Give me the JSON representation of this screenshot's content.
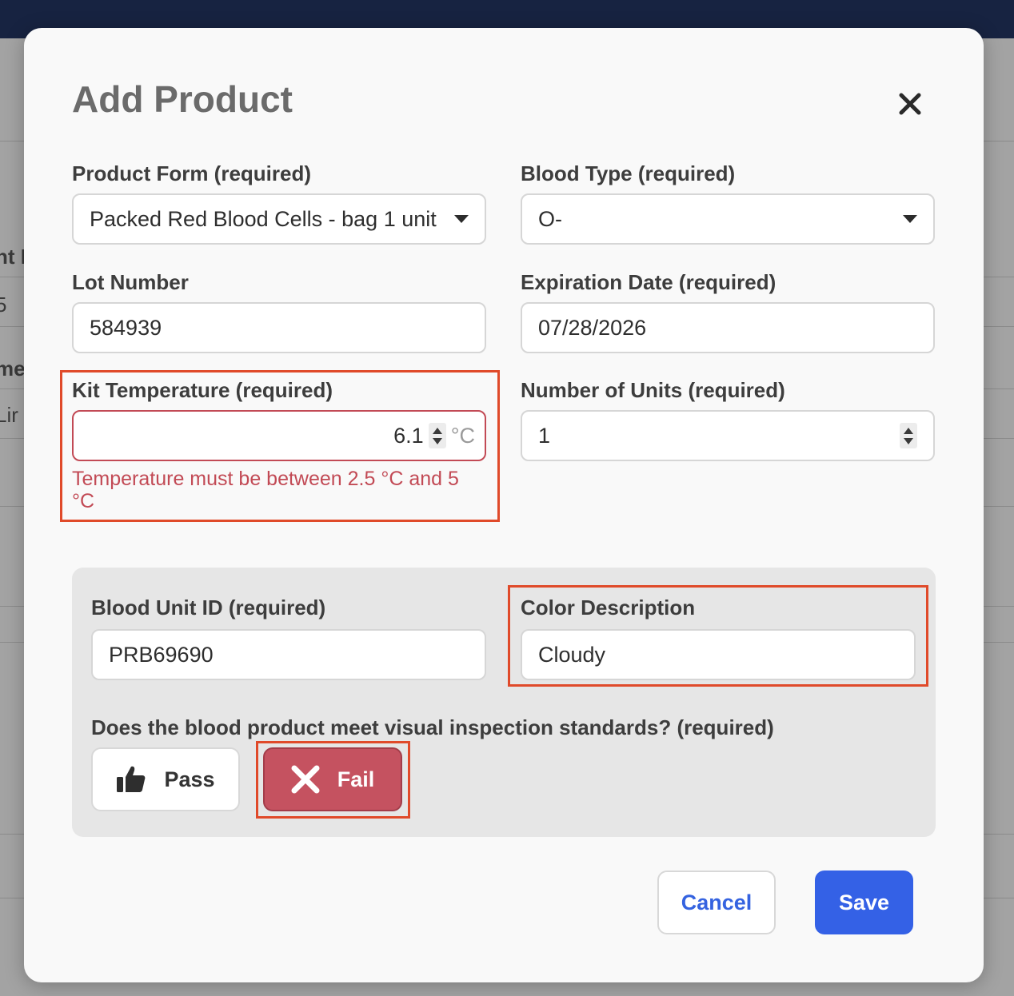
{
  "background": {
    "fragments": [
      "nt I",
      "5",
      "me",
      "Lir"
    ]
  },
  "modal": {
    "title": "Add Product",
    "close_icon": "close-icon"
  },
  "form": {
    "product_form": {
      "label": "Product Form (required)",
      "value": "Packed Red Blood Cells - bag 1 unit"
    },
    "blood_type": {
      "label": "Blood Type (required)",
      "value": "O-"
    },
    "lot_number": {
      "label": "Lot Number",
      "value": "584939"
    },
    "expiration_date": {
      "label": "Expiration Date (required)",
      "value": "07/28/2026"
    },
    "kit_temperature": {
      "label": "Kit Temperature (required)",
      "value": "6.1",
      "unit": "°C",
      "error": "Temperature must be between 2.5 °C and 5 °C"
    },
    "number_of_units": {
      "label": "Number of Units (required)",
      "value": "1"
    }
  },
  "inspection": {
    "blood_unit_id": {
      "label": "Blood Unit ID (required)",
      "value": "PRB69690"
    },
    "color_description": {
      "label": "Color Description",
      "value": "Cloudy"
    },
    "question": "Does the blood product meet visual inspection standards? (required)",
    "pass_label": "Pass",
    "fail_label": "Fail",
    "selected": "Fail"
  },
  "actions": {
    "cancel_label": "Cancel",
    "save_label": "Save"
  },
  "colors": {
    "error": "#c24a55",
    "fail_button": "#c55260",
    "primary": "#3461e6",
    "highlight": "#e04a2a",
    "topbar": "#172341"
  }
}
